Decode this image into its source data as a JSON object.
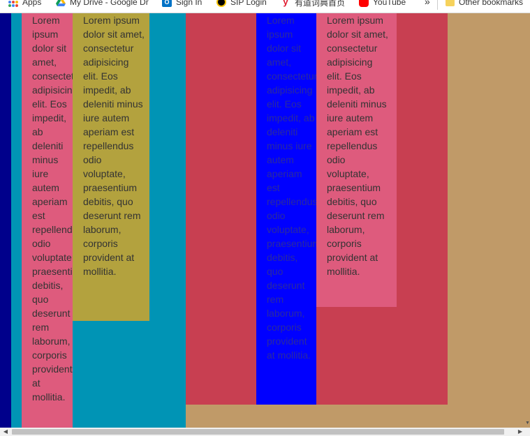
{
  "bookmarks": [
    {
      "id": "apps",
      "label": "Apps"
    },
    {
      "id": "drive",
      "label": "My Drive - Google Dr"
    },
    {
      "id": "sign",
      "label": "Sign In"
    },
    {
      "id": "sip",
      "label": "SIP Login"
    },
    {
      "id": "youdao",
      "label": "有道词典首页"
    },
    {
      "id": "yt",
      "label": "YouTube"
    },
    {
      "id": "more",
      "label": "»"
    },
    {
      "id": "other",
      "label": "Other bookmarks"
    }
  ],
  "lorem": "Lorem ipsum dolor sit amet, consectetur adipisicing elit. Eos impedit, ab deleniti minus iure autem aperiam est repellendus odio voluptate, praesentium debitis, quo deserunt rem laborum, corporis provident at mollitia.",
  "colors": {
    "navy": "#00008b",
    "teal": "#0094b5",
    "pink": "#de5b7d",
    "olive": "#b3a23e",
    "crimson": "#c83f51",
    "blue": "#0000ff",
    "tan": "#c09a68"
  }
}
